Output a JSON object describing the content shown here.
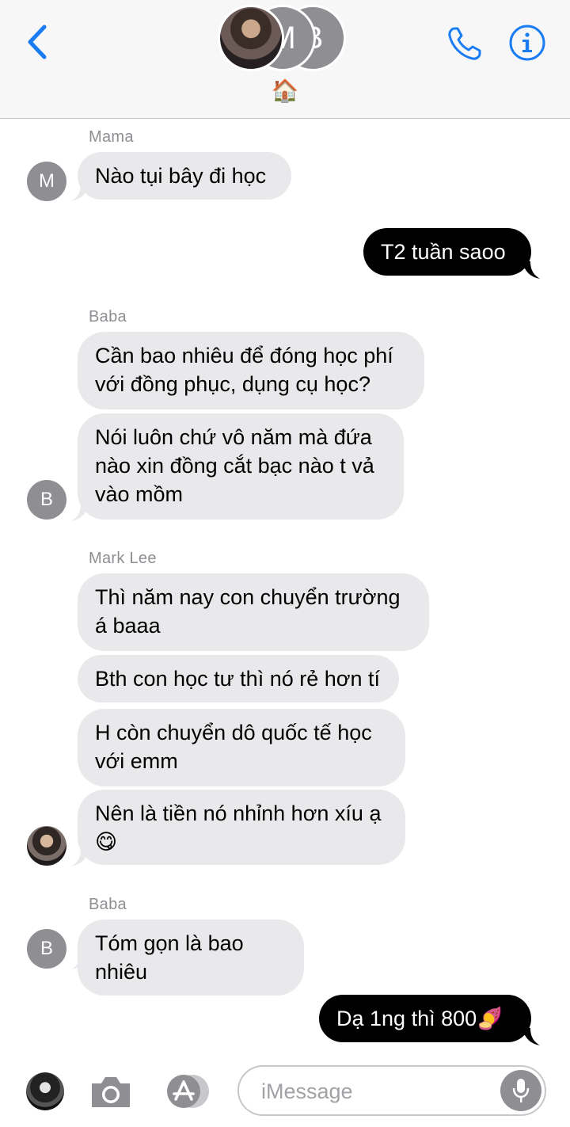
{
  "header": {
    "group_initials": [
      "M",
      "B"
    ],
    "group_emoji": "🏠"
  },
  "messages": [
    {
      "sender": "Mama",
      "text": "Nào tụi bây đi học",
      "avatar": "M"
    },
    {
      "sender": "me",
      "text": "T2 tuần saoo"
    },
    {
      "sender": "Baba",
      "lines": [
        "Cần bao nhiêu để đóng học phí",
        "với đồng phục, dụng cụ học?"
      ]
    },
    {
      "sender": "Baba",
      "lines": [
        "Nói luôn chứ vô năm mà đứa",
        "nào xin đồng cắt bạc nào t vả",
        "vào mồm"
      ],
      "avatar": "B"
    },
    {
      "sender": "Mark Lee",
      "lines": [
        "Thì năm nay con chuyển trường",
        "á baaa"
      ]
    },
    {
      "sender": "Mark Lee",
      "text": "Bth con học tư thì nó rẻ hơn tí"
    },
    {
      "sender": "Mark Lee",
      "lines": [
        "H còn chuyển dô quốc tế học",
        "với emm"
      ]
    },
    {
      "sender": "Mark Lee",
      "lines": [
        "Nên là tiền nó nhỉnh hơn xíu ạ",
        "😋"
      ]
    },
    {
      "sender": "Baba",
      "text": "Tóm gọn là bao nhiêu",
      "avatar": "B"
    },
    {
      "sender": "me",
      "text": "Dạ 1ng thì 800🍠"
    }
  ],
  "names": {
    "mama": "Mama",
    "baba": "Baba",
    "mark": "Mark Lee"
  },
  "input": {
    "placeholder": "iMessage"
  },
  "colors": {
    "accent": "#1a7cf3",
    "incoming_bubble": "#e9e9eb",
    "outgoing_bubble": "#000000",
    "avatar_gray": "#8e8e93"
  },
  "icons": [
    "back-chevron-icon",
    "phone-icon",
    "info-icon",
    "camera-icon",
    "app-store-icon",
    "microphone-icon"
  ]
}
